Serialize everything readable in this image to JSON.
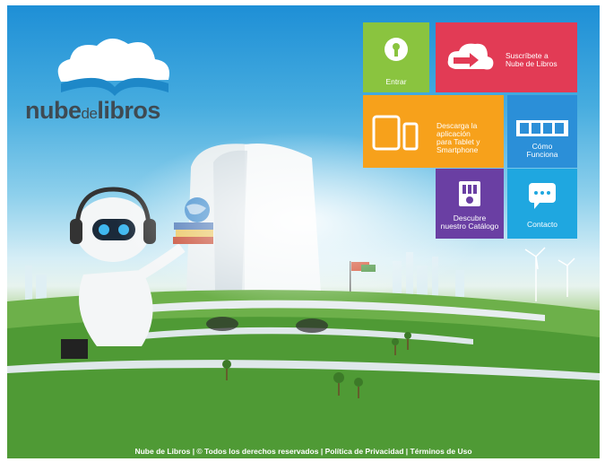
{
  "brand": {
    "name_part1": "nube",
    "name_part2": "de",
    "name_part3": "libros"
  },
  "tiles": {
    "entrar": "Entrar",
    "subscribe_line1": "Suscríbete a",
    "subscribe_line2": "Nube de Libros",
    "download_line1": "Descarga la",
    "download_line2": "aplicación",
    "download_line3": "para Tablet y",
    "download_line4": "Smartphone",
    "how_line1": "Cómo",
    "how_line2": "Funciona",
    "catalog_line1": "Descubre",
    "catalog_line2": "nuestro Catálogo",
    "contact": "Contacto"
  },
  "footer": {
    "copyright": "Nube de Libros | © Todos los derechos reservados",
    "sep": " | ",
    "privacy": "Política de Privacidad",
    "terms": "Términos de Uso"
  },
  "colors": {
    "entrar": "#8ac43f",
    "subscribe": "#e23b55",
    "download": "#f7a11b",
    "how": "#2b8fd8",
    "catalog": "#6a3fa3",
    "contact": "#1fa7e0"
  },
  "icons": {
    "entrar": "keyhole-icon",
    "subscribe": "cloud-arrow-icon",
    "download": "devices-icon",
    "how": "film-strip-icon",
    "catalog": "books-shelf-icon",
    "contact": "chat-bubble-icon"
  }
}
